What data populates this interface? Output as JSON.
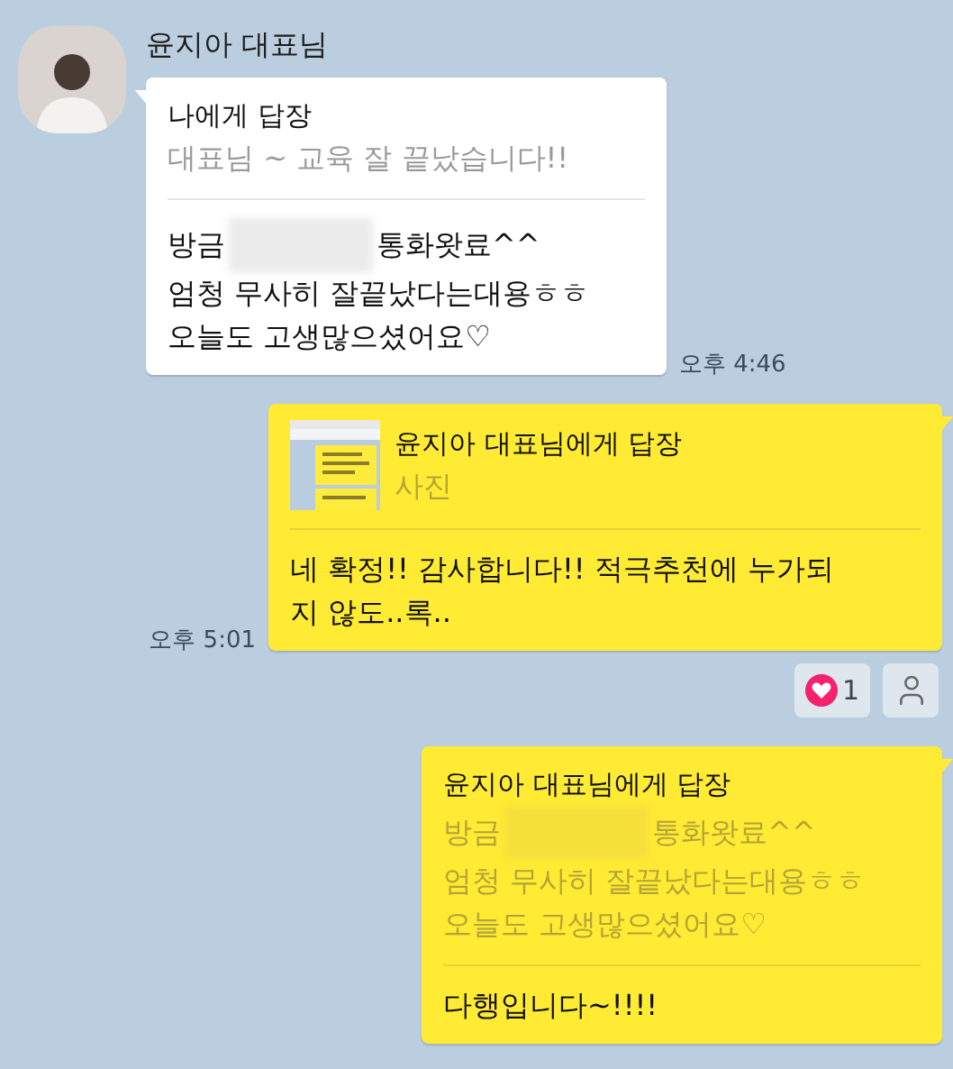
{
  "messages": [
    {
      "kind": "received",
      "sender": "윤지아 대표님",
      "reply_title": "나에게 답장",
      "reply_quote": [
        {
          "segments": [
            {
              "kind": "text",
              "text": "대표님 ~ 교육 잘 끝났습니다!!"
            }
          ]
        }
      ],
      "body": [
        {
          "segments": [
            {
              "kind": "text",
              "text": "방금"
            },
            {
              "kind": "redacted"
            },
            {
              "kind": "text",
              "text": "통화왓료^^"
            }
          ]
        },
        {
          "segments": [
            {
              "kind": "text",
              "text": "엄청 무사히 잘끝났다는대용ㅎㅎ"
            }
          ]
        },
        {
          "segments": [
            {
              "kind": "text",
              "text": "오늘도 고생많으셨어요♡"
            }
          ]
        }
      ],
      "time": "오후 4:46"
    },
    {
      "kind": "sent",
      "reply_title": "윤지아 대표님에게 답장",
      "reply_thumb": {
        "kind": "picture"
      },
      "reply_quote": [
        {
          "segments": [
            {
              "kind": "text",
              "text": "사진"
            }
          ]
        }
      ],
      "body": [
        {
          "segments": [
            {
              "kind": "text",
              "text": "네 확정!! 감사합니다!! 적극추천에 누가되"
            }
          ]
        },
        {
          "segments": [
            {
              "kind": "text",
              "text": "지 않도..록.."
            }
          ]
        }
      ],
      "time": "오후 5:01",
      "reactions": [
        {
          "kind": "heart",
          "count": "1"
        },
        {
          "kind": "person"
        }
      ]
    },
    {
      "kind": "sent",
      "reply_title": "윤지아 대표님에게 답장",
      "reply_quote": [
        {
          "segments": [
            {
              "kind": "text",
              "text": "방금"
            },
            {
              "kind": "redacted"
            },
            {
              "kind": "text",
              "text": "통화왓료^^"
            }
          ]
        },
        {
          "segments": [
            {
              "kind": "text",
              "text": "엄청 무사히 잘끝났다는대용ㅎㅎ"
            }
          ]
        },
        {
          "segments": [
            {
              "kind": "text",
              "text": "오늘도 고생많으셨어요♡"
            }
          ]
        }
      ],
      "body": [
        {
          "segments": [
            {
              "kind": "text",
              "text": "다행입니다~!!!!"
            }
          ]
        }
      ]
    }
  ]
}
